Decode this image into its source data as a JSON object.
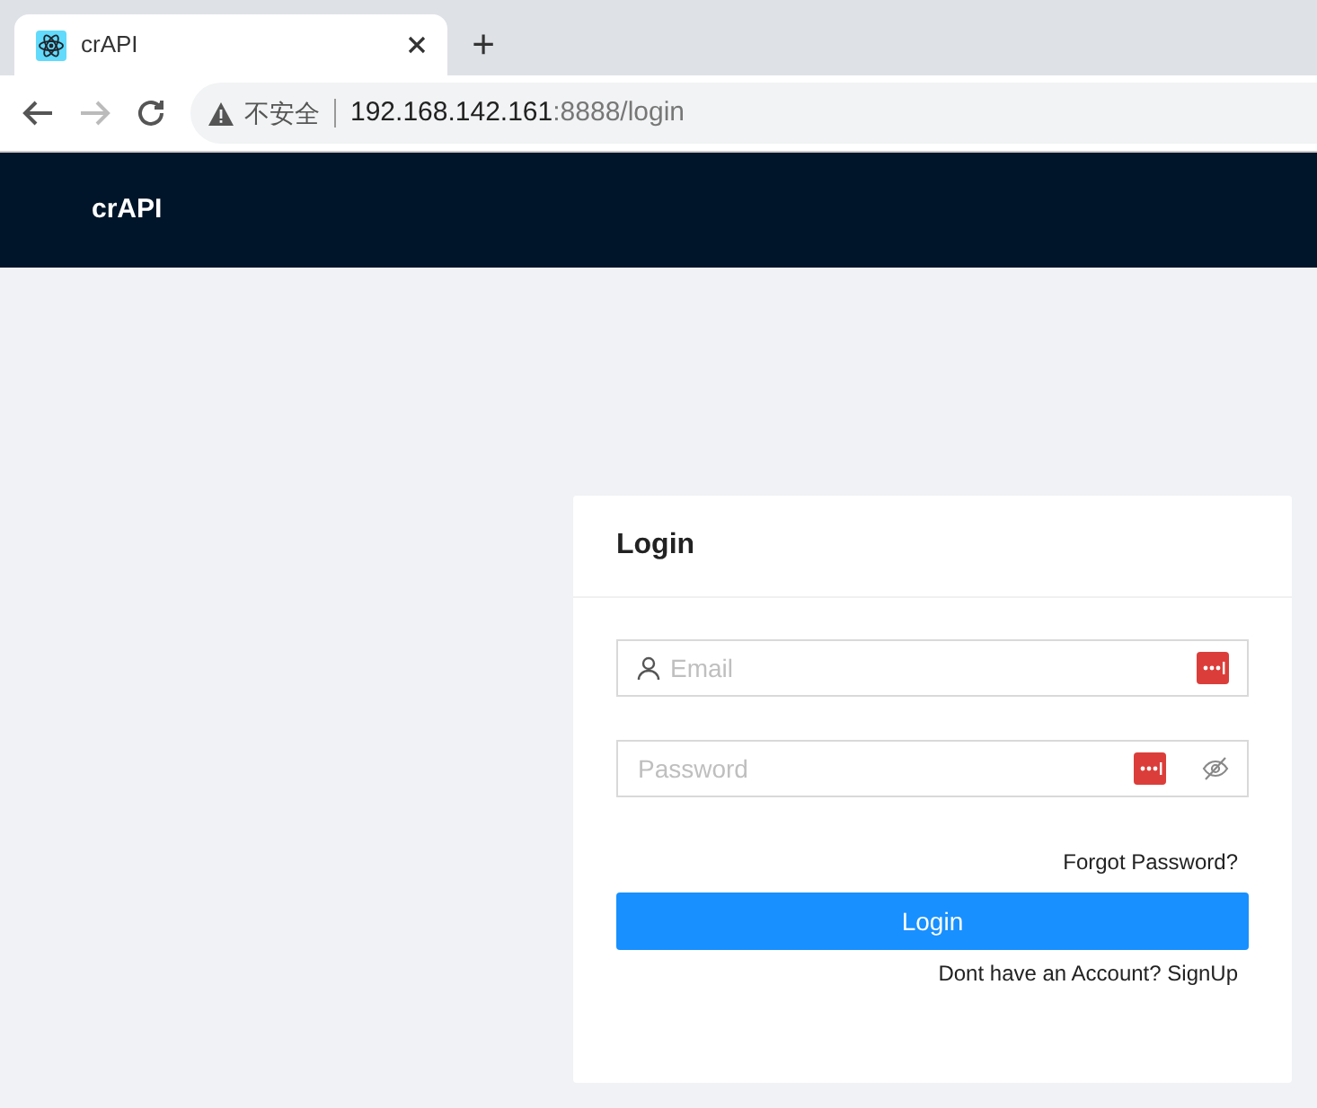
{
  "browser": {
    "tab": {
      "title": "crAPI"
    },
    "new_tab": "+",
    "security_label": "不安全",
    "url_host": "192.168.142.161",
    "url_path": ":8888/login"
  },
  "navbar": {
    "brand": "crAPI"
  },
  "login_card": {
    "title": "Login",
    "fields": [
      {
        "kind": "email",
        "placeholder": "Email"
      },
      {
        "kind": "password",
        "placeholder": "Password"
      }
    ],
    "forgot_link": "Forgot Password?",
    "submit": "Login",
    "signup_link": "Dont have an Account? SignUp"
  }
}
